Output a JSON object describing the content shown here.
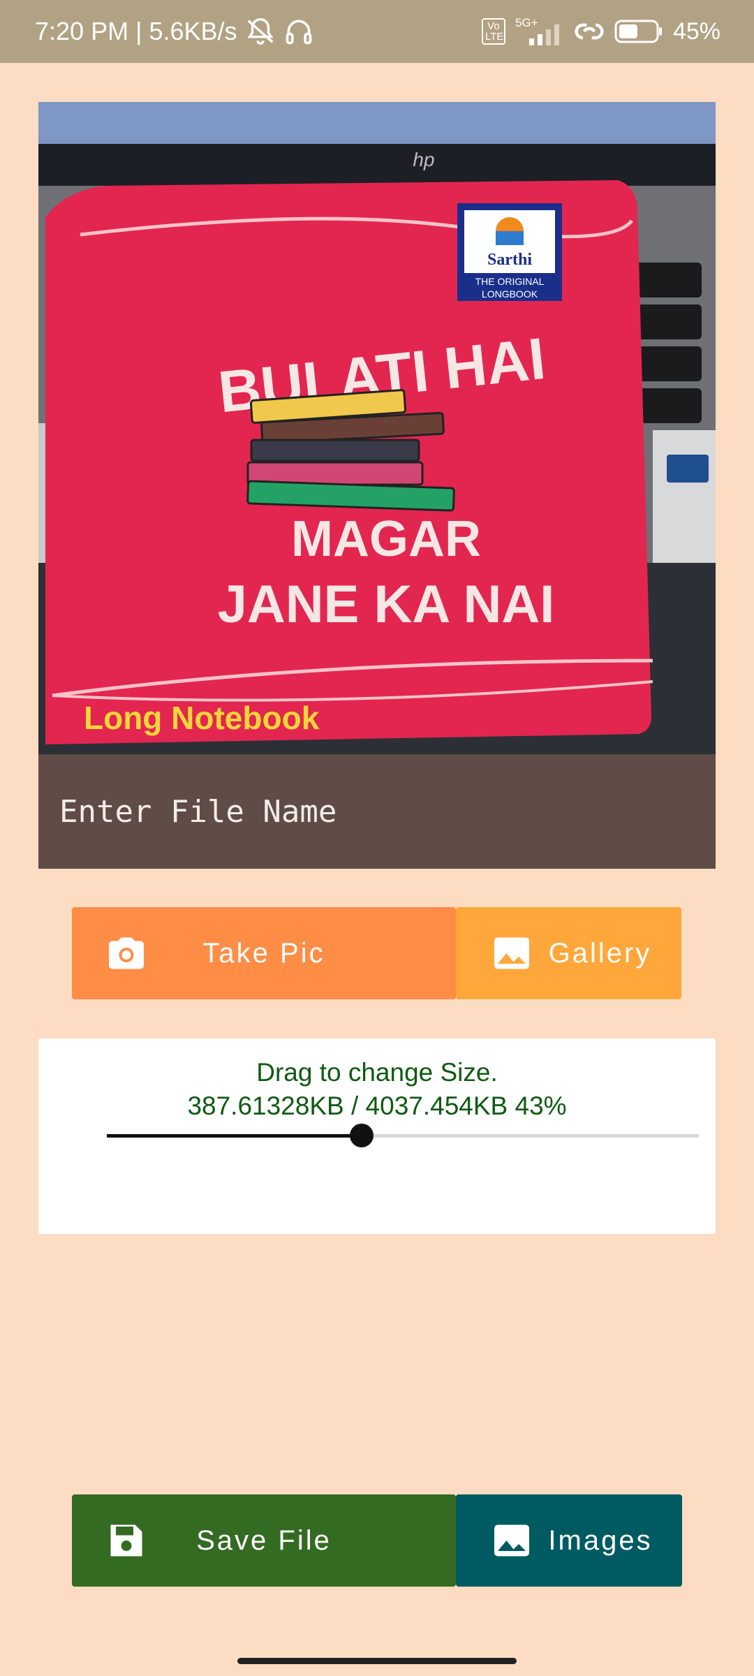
{
  "status": {
    "time": "7:20 PM",
    "separator": "|",
    "speed": "5.6KB/s",
    "volte": "Vo LTE",
    "network": "5G+",
    "battery": "45%"
  },
  "photo": {
    "brand": "Sarthi",
    "brand_sub1": "THE ORIGINAL",
    "brand_sub2": "LONGBOOK",
    "line1": "BULATI HAI",
    "line2": "MAGAR",
    "line3": "JANE KA NAI",
    "footer": "Long Notebook",
    "laptop_logo": "hp"
  },
  "file": {
    "placeholder": "Enter File Name"
  },
  "buttons": {
    "take_pic": "Take Pic",
    "gallery": "Gallery",
    "save_file": "Save File",
    "images": "Images"
  },
  "size": {
    "title": "Drag to change Size.",
    "value": "387.61328KB / 4037.454KB 43%",
    "percent": 43
  },
  "colors": {
    "take": "#ff8d46",
    "gallery": "#ffa73a",
    "save": "#346b22",
    "images": "#005a61"
  }
}
